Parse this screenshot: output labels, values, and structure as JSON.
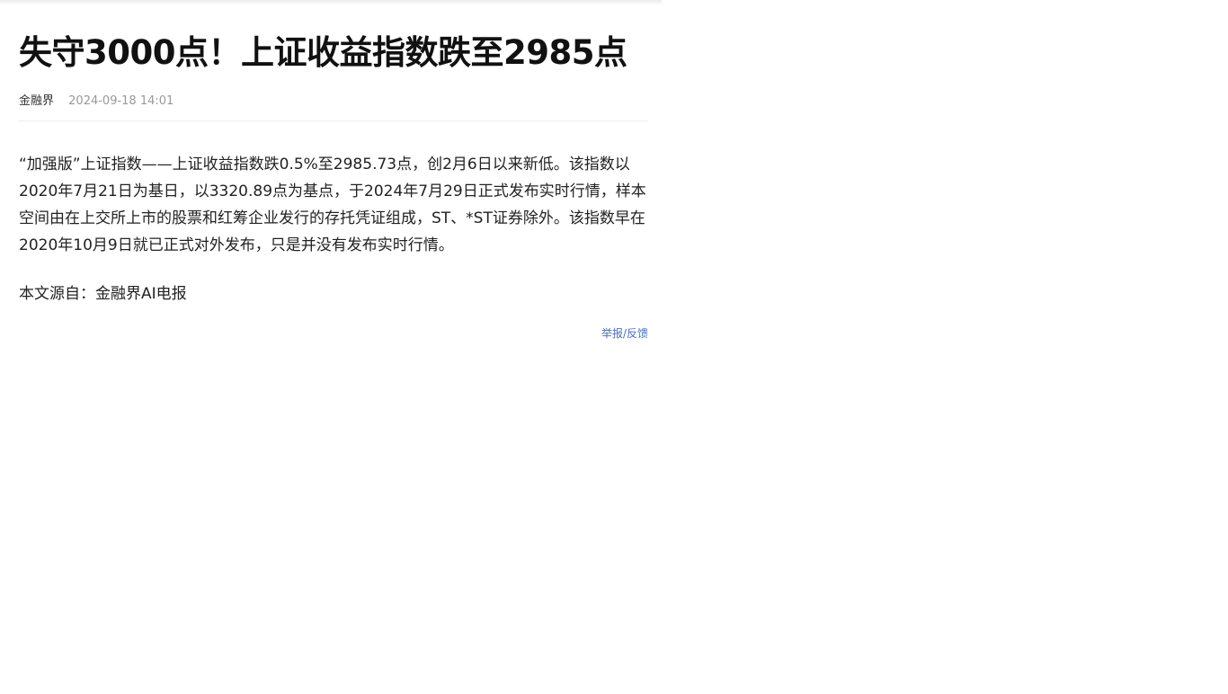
{
  "article": {
    "title": "失守3000点！上证收益指数跌至2985点",
    "source": "金融界",
    "time": "2024-09-18 14:01",
    "paragraphs": [
      "“加强版”上证指数——上证收益指数跌0.5%至2985.73点，创2月6日以来新低。该指数以2020年7月21日为基日，以3320.89点为基点，于2024年7月29日正式发布实时行情，样本空间由在上交所上市的股票和红筹企业发行的存托凭证组成，ST、*ST证券除外。该指数早在2020年10月9日就已正式对外发布，只是并没有发布实时行情。",
      "本文源自：金融界AI电报"
    ],
    "report_label": "举报/反馈"
  }
}
